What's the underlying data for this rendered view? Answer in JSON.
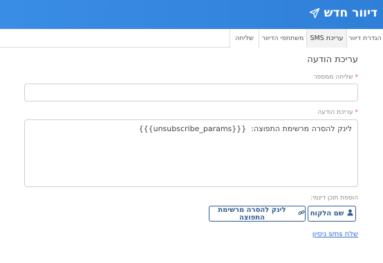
{
  "header": {
    "title": "דיוור חדש",
    "icon": "paper-plane-icon",
    "background_color": "#3a8de4"
  },
  "tabs": [
    {
      "label": "הגדרת דיוור",
      "active": false
    },
    {
      "label": "עריכת SMS",
      "active": true
    },
    {
      "label": "משתתפי הדיוור",
      "active": false
    },
    {
      "label": "שליחה",
      "active": false
    }
  ],
  "form": {
    "section_title": "עריכת הודעה",
    "sender": {
      "label": "שליחה ממספר",
      "required_mark": "*",
      "value": ""
    },
    "message": {
      "label": "עריכת הודעה",
      "required_mark": "*",
      "value": "לינק להסרה מרשימת התפוצה:  {{{unsubscribe_params}}}"
    },
    "dynamic_content": {
      "label": "הוספת תוכן דינמי:",
      "buttons": [
        {
          "label": "שם הלקוח",
          "icon": "user-icon"
        },
        {
          "label": "לינק להסרה מרשימת התפוצה",
          "icon": "link-icon"
        }
      ]
    },
    "test_link": "שלח sms ניסיון"
  },
  "colors": {
    "accent": "#2f7fd8",
    "button_border": "#2d5a8e",
    "required": "#d9534f",
    "link": "#2f6fcf"
  }
}
